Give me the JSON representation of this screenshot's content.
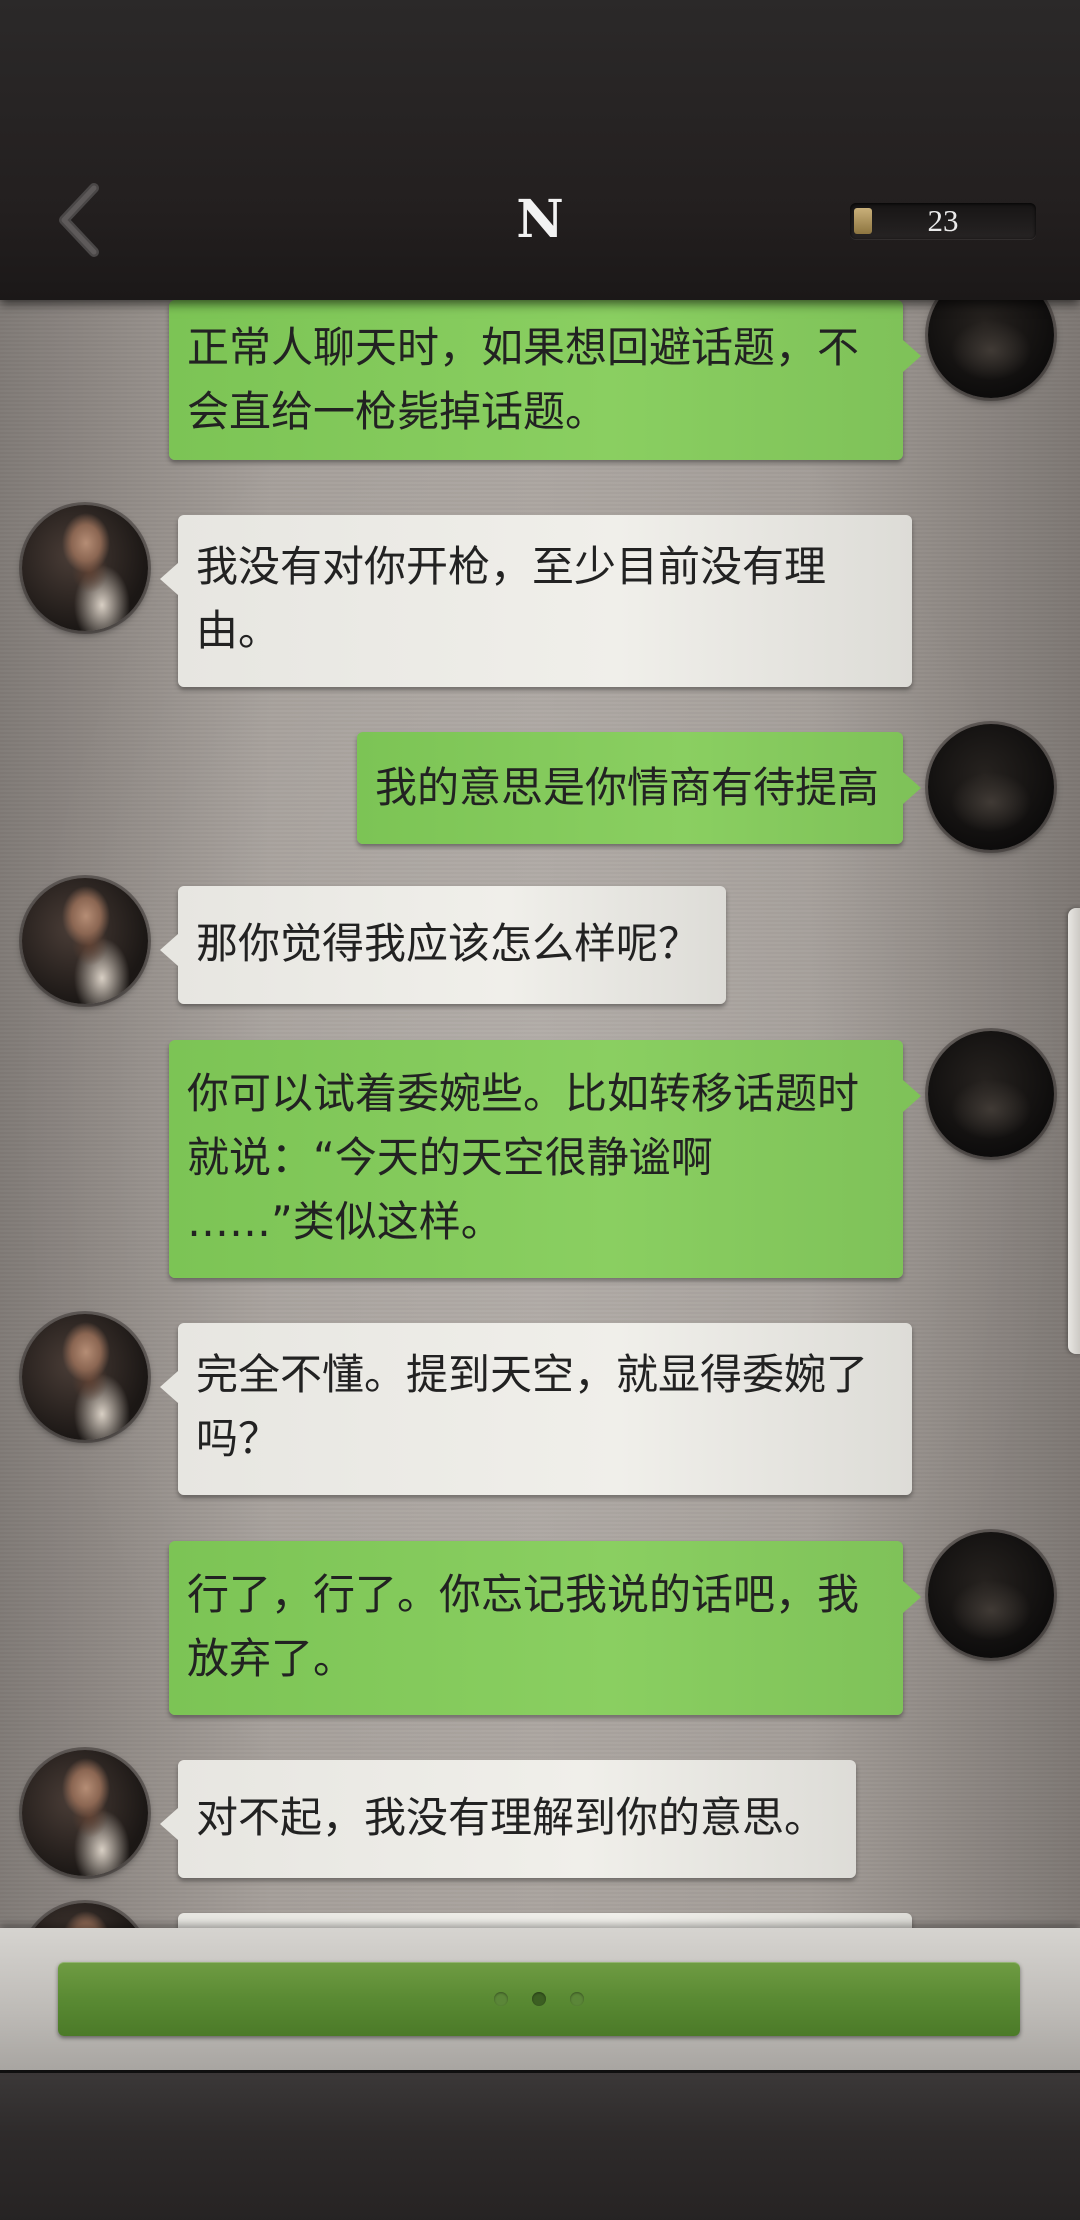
{
  "header": {
    "title": "N",
    "counter": {
      "value": "23",
      "fill_fraction": 0.1
    }
  },
  "messages": [
    {
      "side": "right",
      "text": "正常人聊天时，如果想回避话题，不\n会直给一枪毙掉话题。"
    },
    {
      "side": "left",
      "text": "我没有对你开枪，至少目前没有理\n由。"
    },
    {
      "side": "right",
      "text": "我的意思是你情商有待提高"
    },
    {
      "side": "left",
      "text": "那你觉得我应该怎么样呢？"
    },
    {
      "side": "right",
      "text": "你可以试着委婉些。比如转移话题时\n就说：“今天的天空很静谧啊\n……”类似这样。"
    },
    {
      "side": "left",
      "text": "完全不懂。提到天空，就显得委婉了\n吗？"
    },
    {
      "side": "right",
      "text": "行了，行了。你忘记我说的话吧，我\n放弃了。"
    },
    {
      "side": "left",
      "text": "对不起，我没有理解到你的意思。"
    },
    {
      "side": "left",
      "text": ""
    }
  ],
  "typing_indicator": {
    "dot_count": 3,
    "active_index": 1
  },
  "colors": {
    "outgoing_bubble": "#8acf61",
    "incoming_bubble": "#f0efea",
    "continue_button": "#5a8a33",
    "top_bar": "#231f1f"
  },
  "icons": {
    "back": "chevron-left-icon",
    "incoming_avatar": "contact-avatar",
    "outgoing_avatar": "user-avatar"
  }
}
